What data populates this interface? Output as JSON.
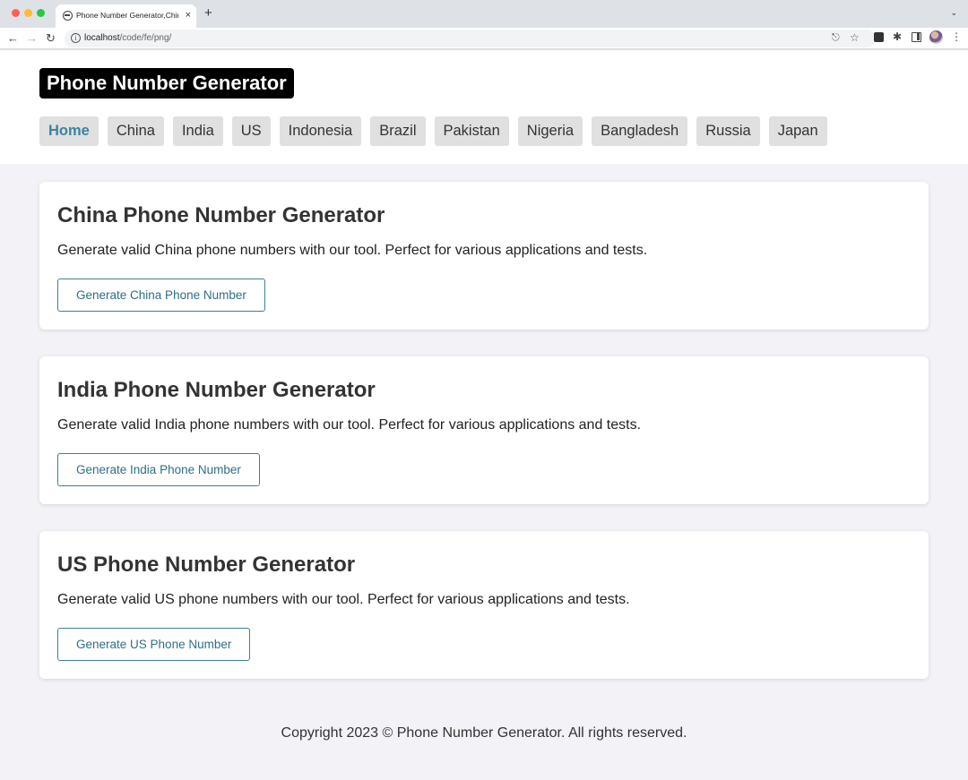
{
  "browser": {
    "tab_title": "Phone Number Generator,China",
    "tab_close": "×",
    "new_tab": "+",
    "url_host": "localhost",
    "url_path": "/code/fe/png/"
  },
  "header": {
    "logo": "Phone Number Generator",
    "nav": [
      {
        "label": "Home",
        "active": true
      },
      {
        "label": "China"
      },
      {
        "label": "India"
      },
      {
        "label": "US"
      },
      {
        "label": "Indonesia"
      },
      {
        "label": "Brazil"
      },
      {
        "label": "Pakistan"
      },
      {
        "label": "Nigeria"
      },
      {
        "label": "Bangladesh"
      },
      {
        "label": "Russia"
      },
      {
        "label": "Japan"
      }
    ]
  },
  "cards": [
    {
      "title": "China Phone Number Generator",
      "description": "Generate valid China phone numbers with our tool. Perfect for various applications and tests.",
      "button": "Generate China Phone Number"
    },
    {
      "title": "India Phone Number Generator",
      "description": "Generate valid India phone numbers with our tool. Perfect for various applications and tests.",
      "button": "Generate India Phone Number"
    },
    {
      "title": "US Phone Number Generator",
      "description": "Generate valid US phone numbers with our tool. Perfect for various applications and tests.",
      "button": "Generate US Phone Number"
    }
  ],
  "footer": {
    "text": "Copyright 2023 © Phone Number Generator. All rights reserved."
  },
  "colors": {
    "accent": "#3a84a0",
    "button_border": "#3f7f96",
    "page_bg": "#f2f2f7",
    "logo_bg": "#000000"
  }
}
